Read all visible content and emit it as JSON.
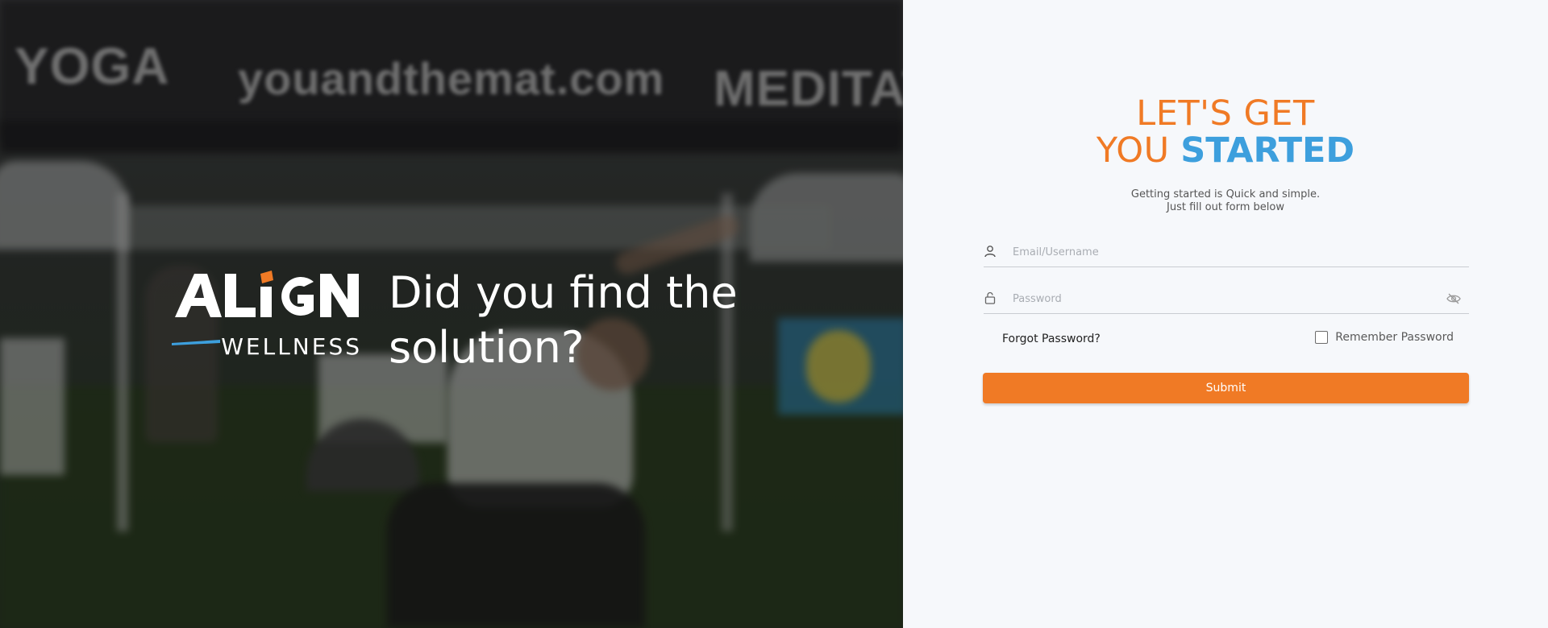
{
  "hero": {
    "canopy_texts": [
      "YOGA",
      "youandthemat.com",
      "MEDITAT"
    ],
    "brand_name": "ALIGN",
    "brand_sub": "WELLNESS",
    "tagline": "Did you find the solution?"
  },
  "form": {
    "heading_line1": "LET'S GET",
    "heading_line2_a": "YOU",
    "heading_line2_b": "STARTED",
    "subtitle_line1": "Getting started is Quick and simple.",
    "subtitle_line2": "Just fill out form below",
    "email_placeholder": "Email/Username",
    "email_value": "",
    "password_placeholder": "Password",
    "password_value": "",
    "forgot_label": "Forgot Password?",
    "remember_label": "Remember Password",
    "remember_checked": false,
    "submit_label": "Submit",
    "icons": [
      "user-icon",
      "lock-icon",
      "eye-off-icon",
      "checkbox"
    ]
  },
  "colors": {
    "accent_orange": "#f07a25",
    "accent_blue": "#3d9fdd",
    "panel_bg": "#f6f8fb"
  }
}
